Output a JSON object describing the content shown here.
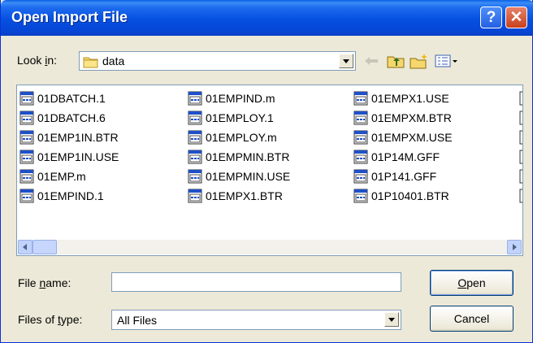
{
  "window": {
    "title": "Open Import File"
  },
  "titlebar_buttons": {
    "help": "?",
    "close": "✕"
  },
  "lookin": {
    "label_pre": "Look ",
    "label_key": "i",
    "label_post": "n:",
    "value": "data"
  },
  "toolbar": [
    "back-icon",
    "up-folder-icon",
    "new-folder-icon",
    "view-menu-icon"
  ],
  "files": {
    "col1": [
      "01DBATCH.1",
      "01DBATCH.6",
      "01EMP1IN.BTR",
      "01EMP1IN.USE",
      "01EMP.m",
      "01EMPIND.1"
    ],
    "col2": [
      "01EMPIND.m",
      "01EMPLOY.1",
      "01EMPLOY.m",
      "01EMPMIN.BTR",
      "01EMPMIN.USE",
      "01EMPX1.BTR"
    ],
    "col3": [
      "01EMPX1.USE",
      "01EMPXM.BTR",
      "01EMPXM.USE",
      "01P14M.GFF",
      "01P141.GFF",
      "01P10401.BTR"
    ]
  },
  "filename": {
    "label_pre": "File ",
    "label_key": "n",
    "label_post": "ame:",
    "value": ""
  },
  "filetype": {
    "label_pre": "Files of ",
    "label_key": "t",
    "label_post": "ype:",
    "value": "All Files"
  },
  "buttons": {
    "open_key": "O",
    "open_rest": "pen",
    "cancel": "Cancel"
  },
  "colors": {
    "title_blue": "#0550e0",
    "close_red": "#c8411d",
    "face": "#ece9d8",
    "border": "#7f9db9"
  }
}
